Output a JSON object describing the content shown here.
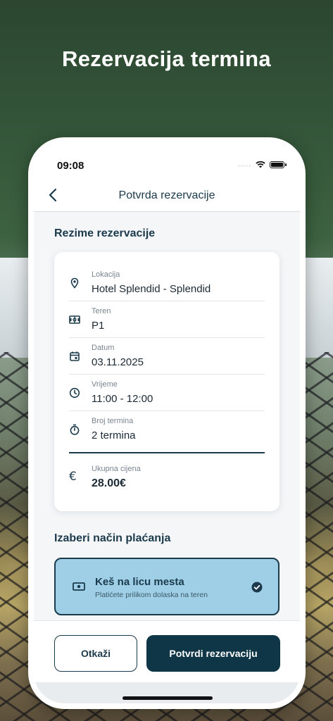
{
  "headline": "Rezervacija termina",
  "status_bar": {
    "time": "09:08",
    "signal": "....."
  },
  "nav": {
    "title": "Potvrda rezervacije"
  },
  "summary": {
    "section_title": "Rezime rezervacije",
    "rows": [
      {
        "label": "Lokacija",
        "value": "Hotel Splendid - Splendid",
        "icon": "location-pin-icon"
      },
      {
        "label": "Teren",
        "value": "P1",
        "icon": "field-icon"
      },
      {
        "label": "Datum",
        "value": "03.11.2025",
        "icon": "calendar-icon"
      },
      {
        "label": "Vrijeme",
        "value": "11:00 - 12:00",
        "icon": "clock-icon"
      },
      {
        "label": "Broj termina",
        "value": "2 termina",
        "icon": "stopwatch-icon"
      }
    ],
    "total": {
      "label": "Ukupna cijena",
      "value": "28.00€",
      "icon": "euro-icon"
    }
  },
  "payment": {
    "section_title": "Izaberi način plaćanja",
    "selected": {
      "title": "Keš na licu mesta",
      "subtitle": "Platićete prilikom dolaska na teren",
      "icon": "cash-icon"
    }
  },
  "actions": {
    "cancel_label": "Otkaži",
    "confirm_label": "Potvrdi rezervaciju"
  },
  "colors": {
    "primary": "#0f3647",
    "selected_bg": "#9ecfe6",
    "text_dark": "#1b3a4b"
  }
}
